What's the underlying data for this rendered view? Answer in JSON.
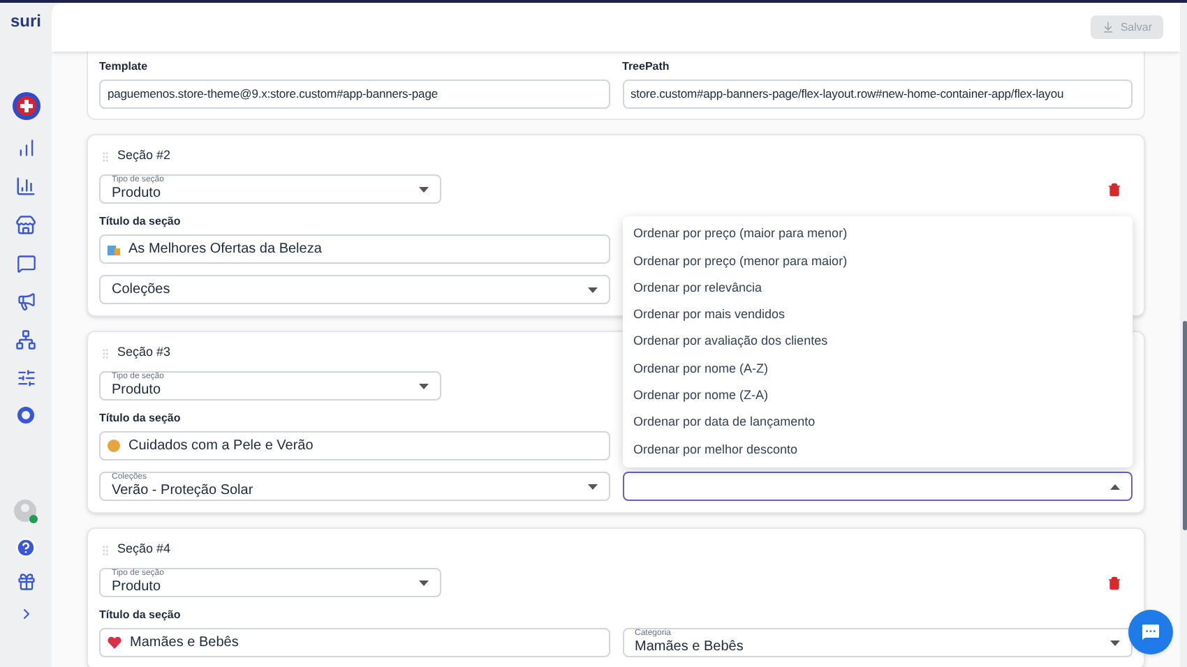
{
  "logo": "suri",
  "header": {
    "save_button": {
      "label": "Salvar",
      "disabled": true
    }
  },
  "top_card": {
    "fields": [
      {
        "label": "Template",
        "value": "paguemenos.store-theme@9.x:store.custom#app-banners-page"
      },
      {
        "label": "TreePath",
        "value": "store.custom#app-banners-page/flex-layout.row#new-home-container-app/flex-layou"
      }
    ]
  },
  "sections": [
    {
      "title": "Seção #2",
      "type_select": {
        "label": "Tipo de seção",
        "value": "Produto"
      },
      "title_label": "Título da seção",
      "title_value": "As Melhores Ofertas da Beleza",
      "collection_select": {
        "placeholder": "Coleções"
      }
    },
    {
      "title": "Seção #3",
      "type_select": {
        "label": "Tipo de seção",
        "value": "Produto"
      },
      "title_label": "Título da seção",
      "title_value": "Cuidados com a Pele e Verão",
      "collection_select": {
        "label": "Coleções",
        "value": "Verão - Proteção Solar"
      },
      "sort_select": {
        "open": true,
        "options": [
          "Ordenar por preço (maior para menor)",
          "Ordenar por preço (menor para maior)",
          "Ordenar por relevância",
          "Ordenar por mais vendidos",
          "Ordenar por avaliação dos clientes",
          "Ordenar por nome (A-Z)",
          "Ordenar por nome (Z-A)",
          "Ordenar por data de lançamento",
          "Ordenar por melhor desconto"
        ]
      }
    },
    {
      "title": "Seção #4",
      "type_select": {
        "label": "Tipo de seção",
        "value": "Produto"
      },
      "title_label": "Título da seção",
      "title_value": "Mamães e Bebês",
      "side_select": {
        "label": "Categoria",
        "value": "Mamães e Bebês"
      }
    }
  ]
}
